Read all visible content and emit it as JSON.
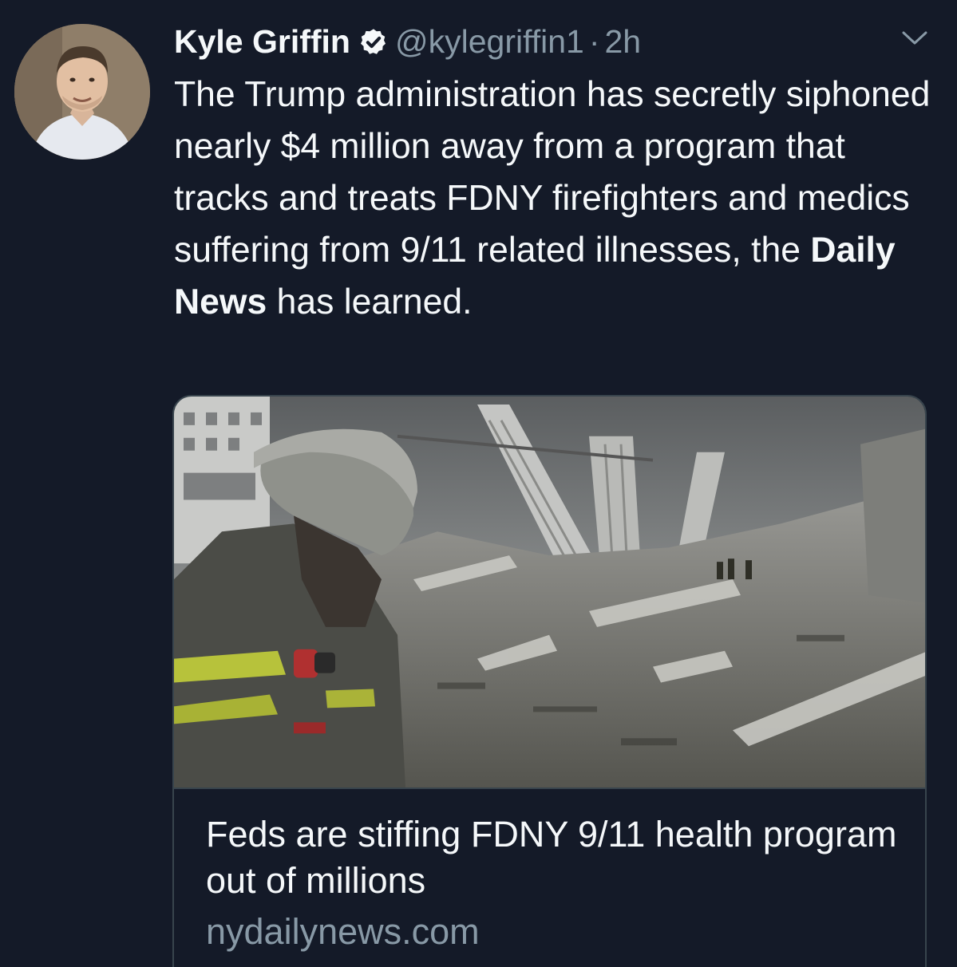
{
  "tweet": {
    "author_name": "Kyle Griffin",
    "handle": "@kylegriffin1",
    "separator": "·",
    "timestamp": "2h",
    "text_part1": "The Trump administration has secretly siphoned nearly $4 million away from a program that tracks and treats FDNY firefighters and medics suffering from 9/11 related illnesses, the ",
    "text_bold": "Daily News",
    "text_part2": " has learned.",
    "icons": {
      "verified": "verified-badge-icon",
      "menu": "chevron-down-icon"
    }
  },
  "card": {
    "image": "firefighter-ruins-photo",
    "title": "Feds are stiffing FDNY 9/11 health program out of millions",
    "domain": "nydailynews.com"
  },
  "colors": {
    "background": "#141a28",
    "primary_text": "#f5f8fa",
    "secondary_text": "#8899a6",
    "border": "#38444d"
  }
}
